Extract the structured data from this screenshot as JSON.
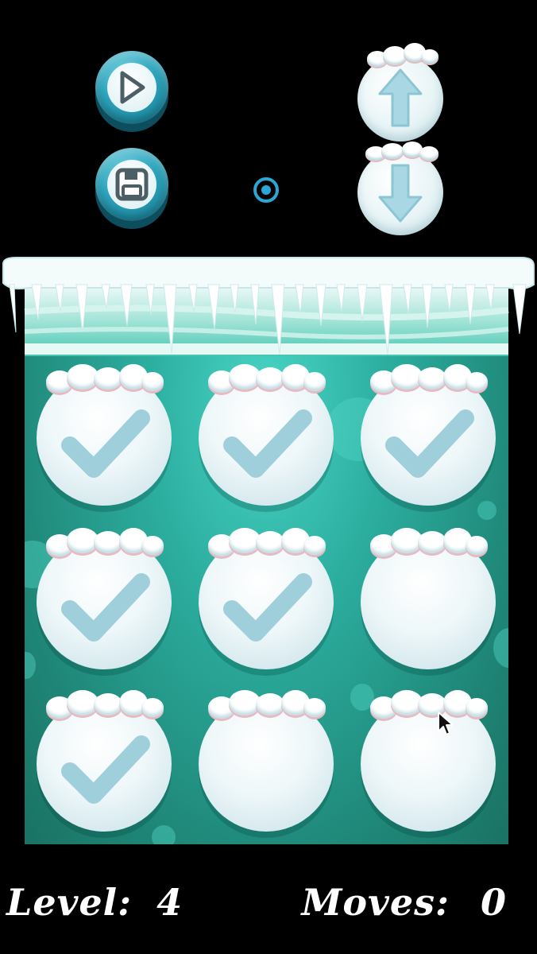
{
  "toolbar": {
    "play_icon": "play-icon",
    "save_icon": "floppy-disk-icon",
    "target_icon": "target-icon",
    "up_icon": "arrow-up-icon",
    "down_icon": "arrow-down-icon"
  },
  "board": {
    "rows": 3,
    "cols": 3,
    "cells": [
      {
        "checked": true
      },
      {
        "checked": true
      },
      {
        "checked": true
      },
      {
        "checked": true
      },
      {
        "checked": true
      },
      {
        "checked": false
      },
      {
        "checked": true
      },
      {
        "checked": false
      },
      {
        "checked": false
      }
    ]
  },
  "status": {
    "level_label": "Level:",
    "level_value": "4",
    "moves_label": "Moves:",
    "moves_value": "0"
  },
  "colors": {
    "board_top": "#48d4c4",
    "board_bottom": "#1a7263",
    "button_teal": "#2aa3bb",
    "check_mark": "#9fd0dc"
  }
}
